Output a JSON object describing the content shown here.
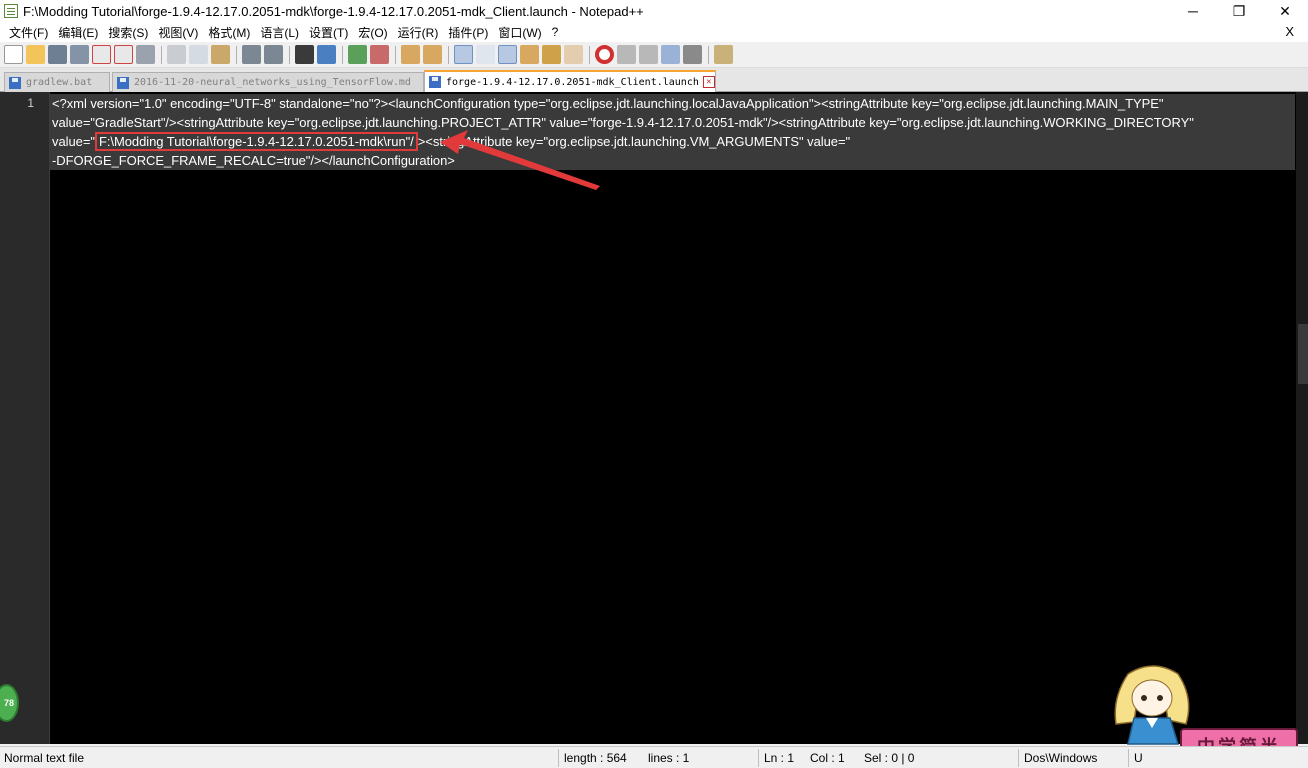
{
  "window": {
    "title": "F:\\Modding Tutorial\\forge-1.9.4-12.17.0.2051-mdk\\forge-1.9.4-12.17.0.2051-mdk_Client.launch - Notepad++",
    "minimize": "─",
    "maximize": "❐",
    "close": "✕"
  },
  "menu": {
    "items": [
      "文件(F)",
      "编辑(E)",
      "搜索(S)",
      "视图(V)",
      "格式(M)",
      "语言(L)",
      "设置(T)",
      "宏(O)",
      "运行(R)",
      "插件(P)",
      "窗口(W)",
      "?"
    ],
    "close": "X"
  },
  "toolbar": {
    "icons": [
      "new-file-icon",
      "open-file-icon",
      "save-icon",
      "save-all-icon",
      "close-icon",
      "close-all-icon",
      "print-icon",
      "cut-icon",
      "copy-icon",
      "paste-icon",
      "undo-icon",
      "redo-icon",
      "find-icon",
      "replace-icon",
      "zoom-in-icon",
      "zoom-out-icon",
      "sync-vertical-icon",
      "sync-horizontal-icon",
      "word-wrap-icon",
      "show-all-chars-icon",
      "indent-guide-icon",
      "doc-map-icon",
      "function-list-icon",
      "folder-workspace-icon",
      "record-macro-icon",
      "stop-record-icon",
      "play-macro-icon",
      "run-macro-multiple-icon",
      "save-macro-icon",
      "launch-browser-icon"
    ]
  },
  "tabs": [
    {
      "label": "gradlew.bat",
      "active": false
    },
    {
      "label": "2016-11-20-neural_networks_using_TensorFlow.md",
      "active": false
    },
    {
      "label": "forge-1.9.4-12.17.0.2051-mdk_Client.launch",
      "active": true
    }
  ],
  "editor": {
    "line_number": "1",
    "lines": {
      "l1": "<?xml version=\"1.0\" encoding=\"UTF-8\" standalone=\"no\"?><launchConfiguration type=\"org.eclipse.jdt.launching.localJavaApplication\"><stringAttribute key=\"org.eclipse.jdt.launching.MAIN_TYPE\"",
      "l2": "value=\"GradleStart\"/><stringAttribute key=\"org.eclipse.jdt.launching.PROJECT_ATTR\" value=\"forge-1.9.4-12.17.0.2051-mdk\"/><stringAttribute key=\"org.eclipse.jdt.launching.WORKING_DIRECTORY\"",
      "l3_pre": "value=\"",
      "l3_hl": "F:\\Modding Tutorial\\forge-1.9.4-12.17.0.2051-mdk\\run\"/",
      "l3_post": "><stringAttribute key=\"org.eclipse.jdt.launching.VM_ARGUMENTS\" value=\"",
      "l4": "-DFORGE_FORCE_FRAME_RECALC=true\"/></launchConfiguration>"
    },
    "highlight_color": "#e23a3a"
  },
  "overlays": {
    "orb_count": "78",
    "badge_text": "中学简半"
  },
  "status": {
    "file_type": "Normal text file",
    "length": "length : 564",
    "lines": "lines : 1",
    "ln": "Ln : 1",
    "col": "Col : 1",
    "sel": "Sel : 0 | 0",
    "eol": "Dos\\Windows",
    "encoding": "U"
  }
}
